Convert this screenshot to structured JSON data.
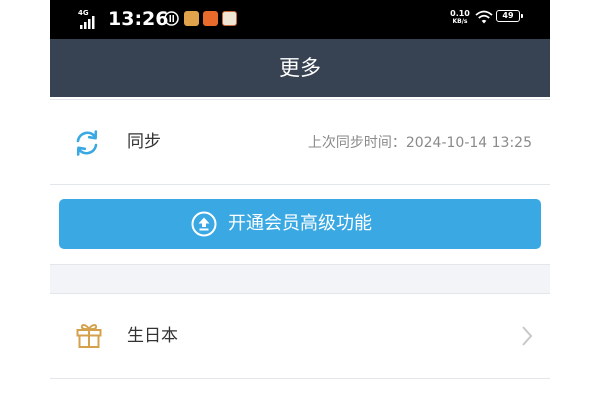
{
  "status_bar": {
    "network": "4G",
    "time": "13:26",
    "speed_value": "0.10",
    "speed_unit": "KB/s",
    "battery": "49",
    "icons": [
      "signal-icon",
      "sim-badge-icon",
      "app-icon-1",
      "weibo-icon",
      "app-icon-3",
      "wifi-icon",
      "battery-icon"
    ]
  },
  "header": {
    "title": "更多"
  },
  "sync": {
    "label": "同步",
    "last_sync_label": "上次同步时间：",
    "last_sync_time": "2024-10-14 13:25",
    "icon": "sync-icon"
  },
  "vip_button": {
    "label": "开通会员高级功能",
    "icon": "upgrade-arrow-icon"
  },
  "birthday": {
    "label": "生日本",
    "icon": "gift-icon"
  },
  "colors": {
    "header_bg": "#374252",
    "accent": "#3aa8e3",
    "gift": "#d4a24c",
    "sync_icon": "#3aa8e3"
  }
}
